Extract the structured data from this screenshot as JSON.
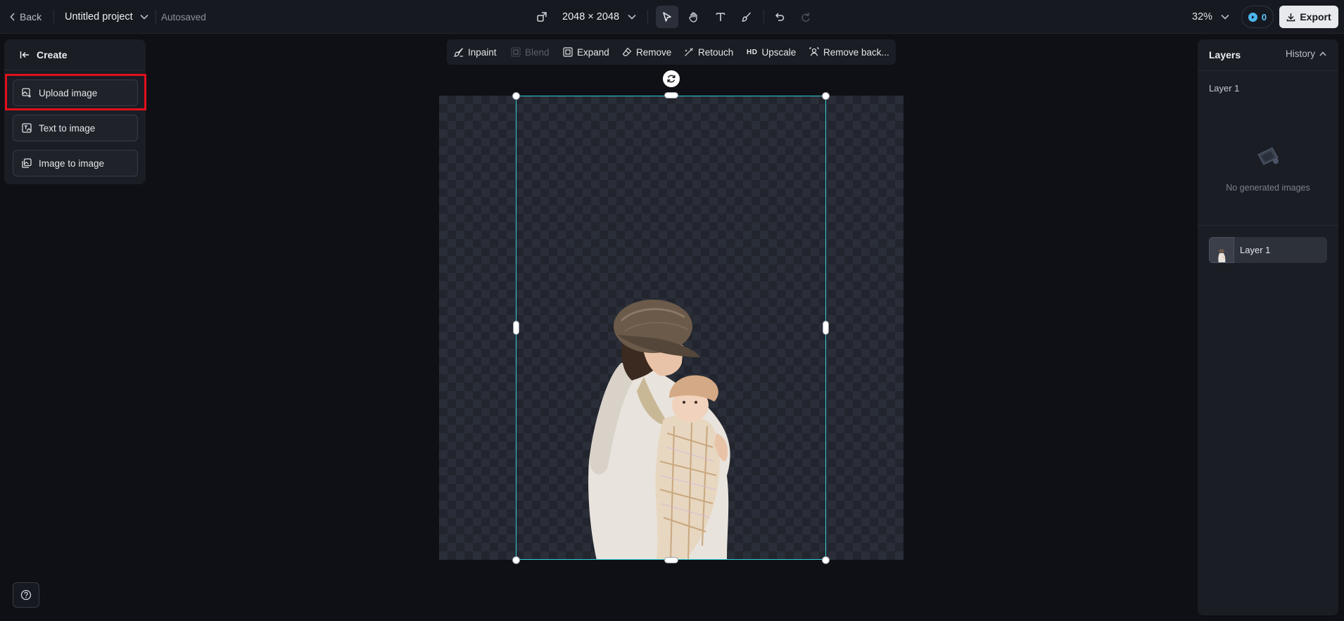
{
  "topbar": {
    "back_label": "Back",
    "project_name": "Untitled project",
    "autosaved_label": "Autosaved",
    "canvas_size": "2048 × 2048",
    "zoom": "32%",
    "credits": "0",
    "export_label": "Export"
  },
  "left_panel": {
    "header": "Create",
    "buttons": [
      "Upload image",
      "Text to image",
      "Image to image"
    ]
  },
  "edit_toolbar": {
    "inpaint": "Inpaint",
    "blend": "Blend",
    "expand": "Expand",
    "remove": "Remove",
    "retouch": "Retouch",
    "upscale_badge": "HD",
    "upscale": "Upscale",
    "remove_background": "Remove back..."
  },
  "right_panel": {
    "title": "Layers",
    "history_label": "History",
    "current_layer": "Layer 1",
    "empty_text": "No generated images",
    "layers": [
      "Layer 1"
    ]
  },
  "colors": {
    "accent_selection": "#2fd0d6",
    "highlight": "#e0101c",
    "credits": "#5ec6ff"
  }
}
